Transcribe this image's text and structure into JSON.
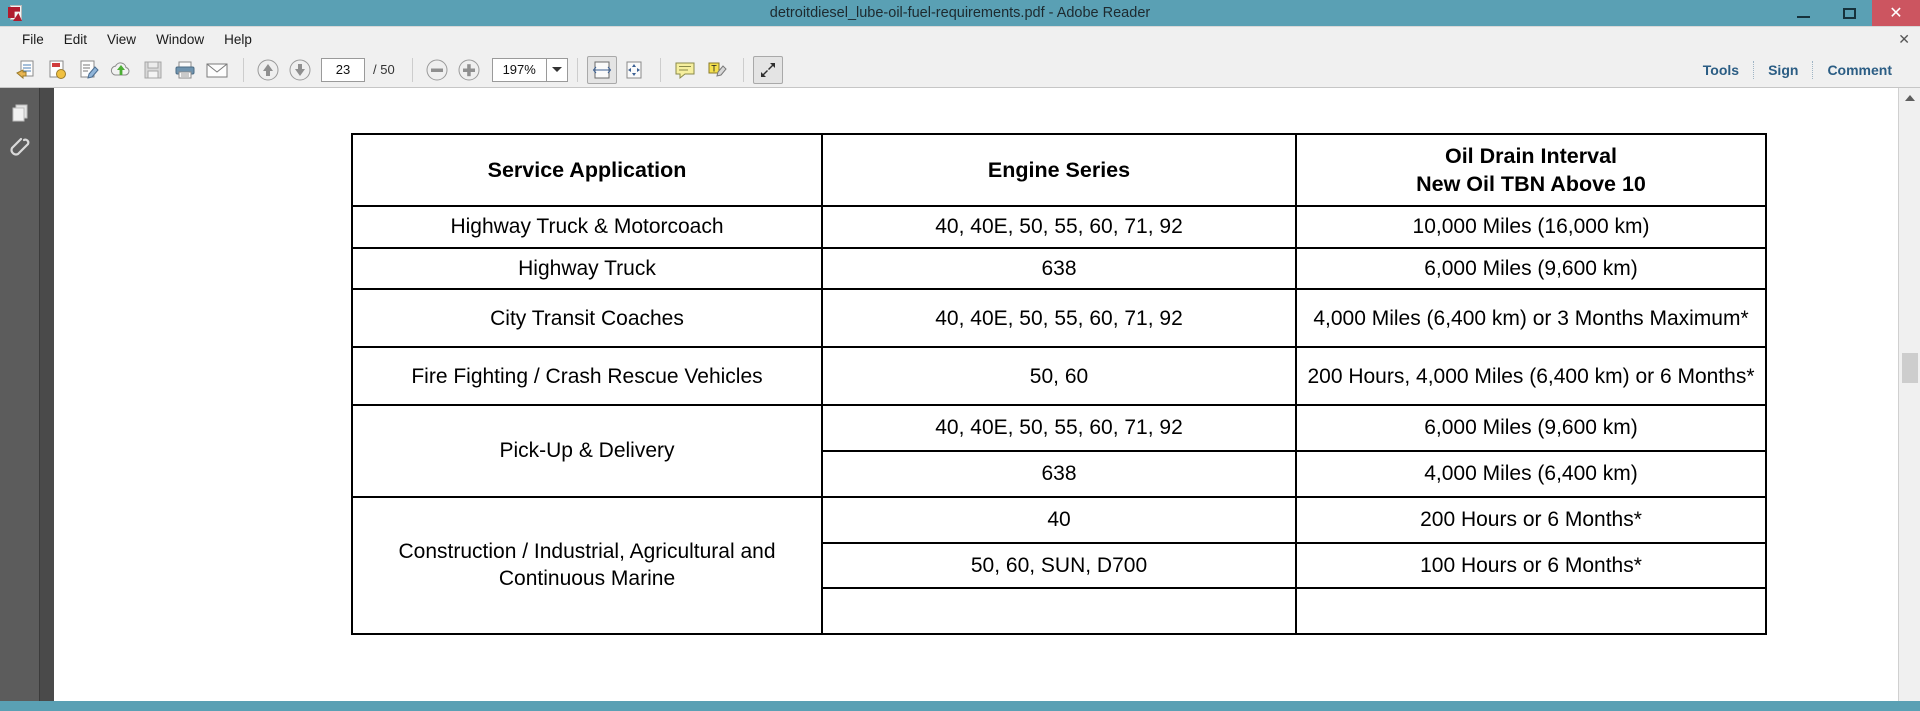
{
  "window": {
    "title": "detroitdiesel_lube-oil-fuel-requirements.pdf - Adobe Reader",
    "app_icon": "adobe-reader-icon",
    "minimize_label": "",
    "maximize_label": "",
    "close_label": "✕",
    "accent_color": "#5aa0b4",
    "close_color": "#cc5560"
  },
  "menubar": {
    "items": [
      "File",
      "Edit",
      "View",
      "Window",
      "Help"
    ],
    "close_label": "✕"
  },
  "toolbar": {
    "left_icons": [
      {
        "name": "open-file-icon",
        "label": ""
      },
      {
        "name": "create-pdf-icon",
        "label": ""
      },
      {
        "name": "edit-pdf-icon",
        "label": ""
      },
      {
        "name": "upload-cloud-icon",
        "label": ""
      },
      {
        "name": "save-icon",
        "label": ""
      },
      {
        "name": "print-icon",
        "label": ""
      },
      {
        "name": "email-icon",
        "label": ""
      }
    ],
    "page_prev_icon": "arrow-up-icon",
    "page_next_icon": "arrow-down-icon",
    "page_number": "23",
    "page_total": "/ 50",
    "zoom_out_icon": "minus-circle-icon",
    "zoom_in_icon": "plus-circle-icon",
    "zoom_value": "197%",
    "fit_width_icon": "fit-width-icon",
    "fit_page_icon": "fit-page-icon",
    "comment_icon": "comment-bubble-icon",
    "highlight_icon": "text-highlight-icon",
    "fullscreen_icon": "fullscreen-icon",
    "right_links": [
      "Tools",
      "Sign",
      "Comment"
    ],
    "link_color": "#2b5d84"
  },
  "left_rail": {
    "items": [
      {
        "name": "page-thumbnails-icon",
        "label": ""
      },
      {
        "name": "attachments-icon",
        "label": ""
      }
    ]
  },
  "document": {
    "table": {
      "headers": [
        "Service Application",
        "Engine Series",
        "Oil Drain Interval\nNew Oil TBN Above 10"
      ],
      "header_line1": "Oil Drain Interval",
      "header_line2": "New Oil TBN Above 10",
      "rows": [
        {
          "service": "Highway Truck & Motorcoach",
          "engine": "40, 40E, 50, 55, 60, 71, 92",
          "interval": "10,000 Miles (16,000 km)"
        },
        {
          "service": "Highway Truck",
          "engine": "638",
          "interval": "6,000 Miles (9,600 km)"
        },
        {
          "service": "City Transit Coaches",
          "engine": "40, 40E, 50, 55, 60, 71, 92",
          "interval": "4,000 Miles (6,400 km) or 3 Months Maximum*"
        },
        {
          "service": "Fire Fighting / Crash Rescue Vehicles",
          "engine": "50, 60",
          "interval": "200 Hours, 4,000 Miles (6,400 km) or 6 Months*"
        }
      ],
      "split_rows": [
        {
          "service": "Pick-Up & Delivery",
          "sub": [
            {
              "engine": "40, 40E, 50, 55, 60, 71, 92",
              "interval": "6,000 Miles (9,600 km)"
            },
            {
              "engine": "638",
              "interval": "4,000 Miles (6,400 km)"
            }
          ]
        },
        {
          "service": "Construction / Industrial, Agricultural and Continuous Marine",
          "sub": [
            {
              "engine": "40",
              "interval": "200 Hours or 6 Months*"
            },
            {
              "engine": "50, 60, SUN, D700",
              "interval": "100 Hours or 6 Months*"
            }
          ]
        }
      ]
    }
  },
  "scrollbar": {
    "up_arrow_icon": "scroll-up-arrow-icon",
    "thumb_name": "vertical-scroll-thumb"
  }
}
